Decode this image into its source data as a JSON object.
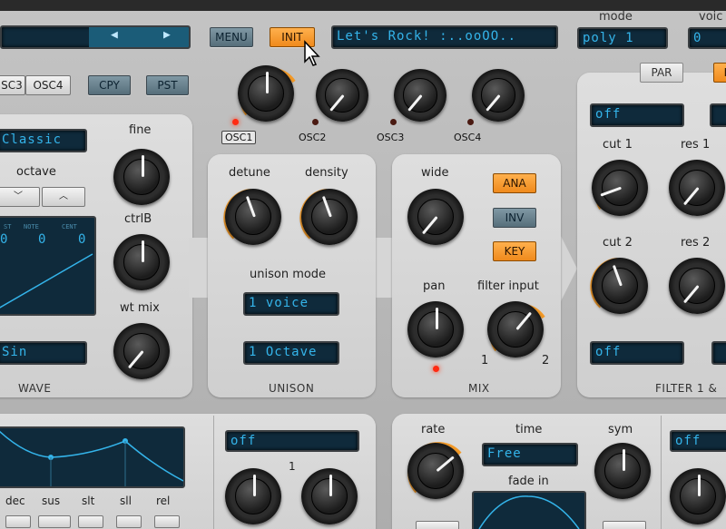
{
  "top": {
    "menu_label": "MENU",
    "init_label": "INIT",
    "preset_name": "Let's Rock! :..ooOO..",
    "mode_label": "mode",
    "mode_value": "poly 1",
    "voices_label": "voic",
    "voices_value": "0"
  },
  "osc_bar": {
    "osc3_label": "SC3",
    "osc4_label": "OSC4",
    "copy_label": "CPY",
    "paste_label": "PST",
    "osc_tags": [
      "OSC1",
      "OSC2",
      "OSC3",
      "OSC4"
    ]
  },
  "wave_panel": {
    "title": "WAVE",
    "wavetable": "Classic",
    "octave_label": "octave",
    "fine_label": "fine",
    "ctrlb_label": "ctrlB",
    "wtmix_label": "wt mix",
    "wave_shape": "Sin",
    "display_headers": [
      "ST",
      "NOTE",
      "CENT"
    ],
    "display_values": [
      "0",
      "0",
      "0"
    ]
  },
  "unison_panel": {
    "title": "UNISON",
    "detune_label": "detune",
    "density_label": "density",
    "mode_label": "unison mode",
    "mode_value": "1 voice",
    "octave_value": "1 Octave"
  },
  "mix_panel": {
    "title": "MIX",
    "wide_label": "wide",
    "pan_label": "pan",
    "filter_input_label": "filter input",
    "filter_min": "1",
    "filter_max": "2",
    "ana_label": "ANA",
    "inv_label": "INV",
    "key_label": "KEY"
  },
  "filter_panel": {
    "title": "FILTER 1 &",
    "par_label": "PAR",
    "lnk_label": "L",
    "filter1_type": "off",
    "filter2_type": "off",
    "cut1_label": "cut 1",
    "res1_label": "res 1",
    "cut2_label": "cut 2",
    "res2_label": "res 2"
  },
  "env_panel": {
    "labels": [
      "dec",
      "sus",
      "slt",
      "sll",
      "rel"
    ]
  },
  "lfo_sel_panel": {
    "value": "off",
    "number": "1"
  },
  "lfo_panel": {
    "rate_label": "rate",
    "time_label": "time",
    "time_value": "Free",
    "sym_label": "sym",
    "fade_label": "fade in",
    "right_value": "off"
  },
  "colors": {
    "accent": "#f39a28",
    "lcd_bg": "#0f2a3b",
    "lcd_text": "#34b4ea",
    "led_on": "#ff2a12"
  }
}
